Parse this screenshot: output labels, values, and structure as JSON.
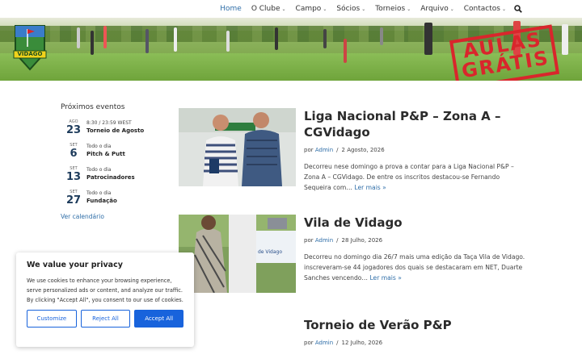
{
  "nav": {
    "items": [
      {
        "label": "Home",
        "has_dropdown": false,
        "active": true
      },
      {
        "label": "O Clube",
        "has_dropdown": true
      },
      {
        "label": "Campo",
        "has_dropdown": true
      },
      {
        "label": "Sócios",
        "has_dropdown": true
      },
      {
        "label": "Torneios",
        "has_dropdown": true
      },
      {
        "label": "Arquivo",
        "has_dropdown": true
      },
      {
        "label": "Contactos",
        "has_dropdown": true
      }
    ],
    "search_icon": "search-icon"
  },
  "banner": {
    "logo_text": "VIDAGO",
    "stamp_line1": "AULAS",
    "stamp_line2": "GRÁTIS"
  },
  "events": {
    "heading": "Próximos eventos",
    "list": [
      {
        "month": "AGO",
        "day": "23",
        "time": "8:30 / 23:59 WEST",
        "title": "Torneio de Agosto"
      },
      {
        "month": "SET",
        "day": "6",
        "time": "Todo o dia",
        "title": "Pitch & Putt"
      },
      {
        "month": "SET",
        "day": "13",
        "time": "Todo o dia",
        "title": "Patrocinadores"
      },
      {
        "month": "SET",
        "day": "27",
        "time": "Todo o dia",
        "title": "Fundação"
      }
    ],
    "calendar_link": "Ver calendário"
  },
  "posts": [
    {
      "title": "Liga Nacional P&P – Zona A – CGVidago",
      "by": "por",
      "author": "Admin",
      "date": "2 Agosto, 2026",
      "excerpt": "Decorreu nese domingo a prova a contar para a Liga Nacional P&P – Zona A – CGVidago. De entre os inscritos destacou-se Fernando Sequeira com…",
      "more": "Ler mais »"
    },
    {
      "title": "Vila de Vidago",
      "by": "por",
      "author": "Admin",
      "date": "28 Julho, 2026",
      "excerpt": "Decorreu no domingo dia 26/7 mais uma edição da Taça Vila de Vidago. inscreveram-se 44 jogadores dos quais se destacaram em NET, Duarte Sanches vencendo…",
      "more": "Ler mais »"
    },
    {
      "title": "Torneio de Verão P&P",
      "by": "por",
      "author": "Admin",
      "date": "12 Julho, 2026",
      "excerpt": "",
      "more": ""
    }
  ],
  "cookie": {
    "title": "We value your privacy",
    "text": "We use cookies to enhance your browsing experience, serve personalized ads or content, and analyze our traffic. By clicking \"Accept All\", you consent to our use of cookies.",
    "customize": "Customize",
    "reject": "Reject All",
    "accept": "Accept All"
  },
  "colors": {
    "link": "#2f6ea8",
    "primary_button": "#1863dc",
    "stamp": "#d9262c"
  }
}
